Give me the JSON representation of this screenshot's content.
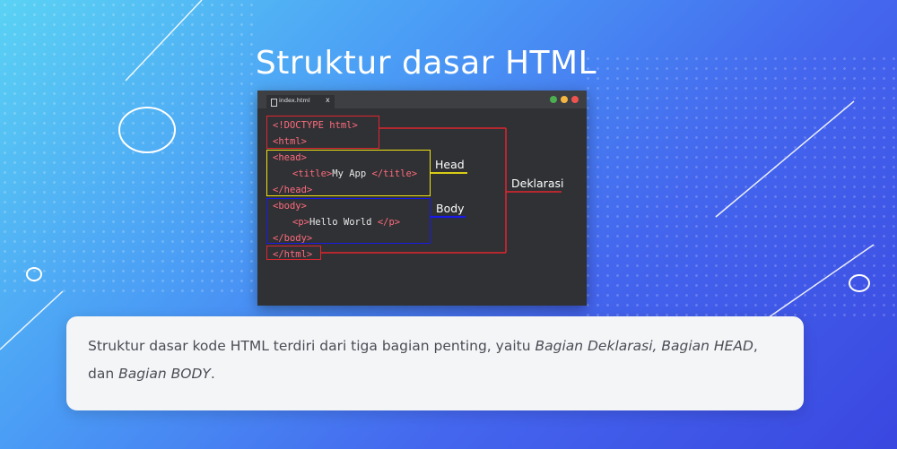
{
  "title": "Struktur dasar HTML",
  "editor": {
    "tab_name": "index.html",
    "tab_close": "x",
    "lines": {
      "doctype": "<!DOCTYPE html>",
      "html_open": "<html>",
      "head_open": "<head>",
      "title_open": "<title>",
      "title_text": "My App",
      "title_close": "</title>",
      "head_close": "</head>",
      "body_open": "<body>",
      "p_open": "<p>",
      "p_text": "Hello World",
      "p_close": "</p>",
      "body_close": "</body>",
      "html_close": "</html>"
    },
    "traffic_lights": [
      "#4caf50",
      "#f5b642",
      "#ef5350"
    ]
  },
  "annotations": {
    "head": "Head",
    "body": "Body",
    "declaration": "Deklarasi"
  },
  "colors": {
    "declaration_box": "#e0262f",
    "head_box": "#f2e313",
    "body_box": "#1a1ae6"
  },
  "description": {
    "intro": "Struktur dasar kode HTML terdiri dari tiga bagian penting, yaitu ",
    "part1": "Bagian Deklarasi,",
    "part2": "Bagian HEAD",
    "connector": ", dan ",
    "part3": "Bagian BODY",
    "end": "."
  }
}
